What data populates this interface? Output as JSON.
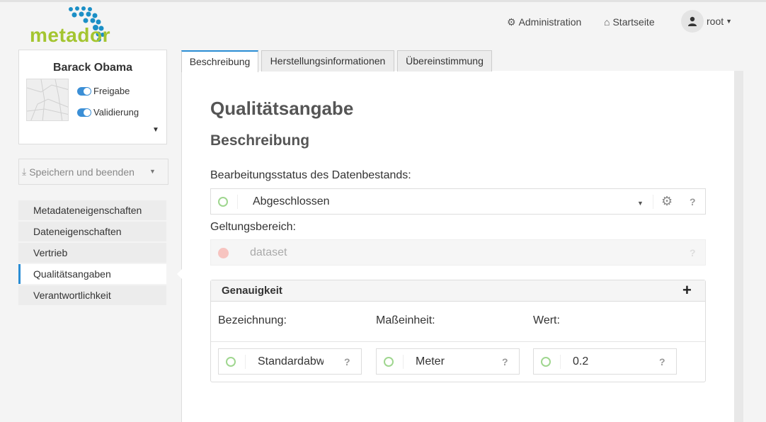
{
  "logo": {
    "text": "metador"
  },
  "topnav": {
    "admin": "Administration",
    "home": "Startseite",
    "user": "root"
  },
  "profile": {
    "name": "Barack Obama",
    "toggles": [
      {
        "label": "Freigabe",
        "on": true
      },
      {
        "label": "Validierung",
        "on": true
      }
    ]
  },
  "save": {
    "label": "Speichern und beenden"
  },
  "sidebar": {
    "items": [
      {
        "label": "Metadateneigenschaften"
      },
      {
        "label": "Dateneigenschaften"
      },
      {
        "label": "Vertrieb"
      },
      {
        "label": "Qualitätsangaben",
        "active": true
      },
      {
        "label": "Verantwortlichkeit"
      }
    ]
  },
  "tabs": [
    {
      "label": "Beschreibung",
      "active": true
    },
    {
      "label": "Herstellungsinformationen"
    },
    {
      "label": "Übereinstimmung"
    }
  ],
  "main": {
    "title": "Qualitätsangabe",
    "section": "Beschreibung",
    "status_label": "Bearbeitungsstatus des Datenbestands:",
    "status_value": "Abgeschlossen",
    "scope_label": "Geltungsbereich:",
    "scope_value": "dataset",
    "help": "?"
  },
  "accuracy": {
    "title": "Genauigkeit",
    "add": "+",
    "columns": [
      "Bezeichnung:",
      "Maßeinheit:",
      "Wert:"
    ],
    "values": [
      "Standardabweichung",
      "Meter",
      "0.2"
    ]
  },
  "colors": {
    "accent": "#2a8dd4",
    "logo_green": "#a4c530",
    "logo_blue": "#1b8fc6",
    "ok_circle": "#9fd68f",
    "error_circle": "#f7c4c0"
  }
}
